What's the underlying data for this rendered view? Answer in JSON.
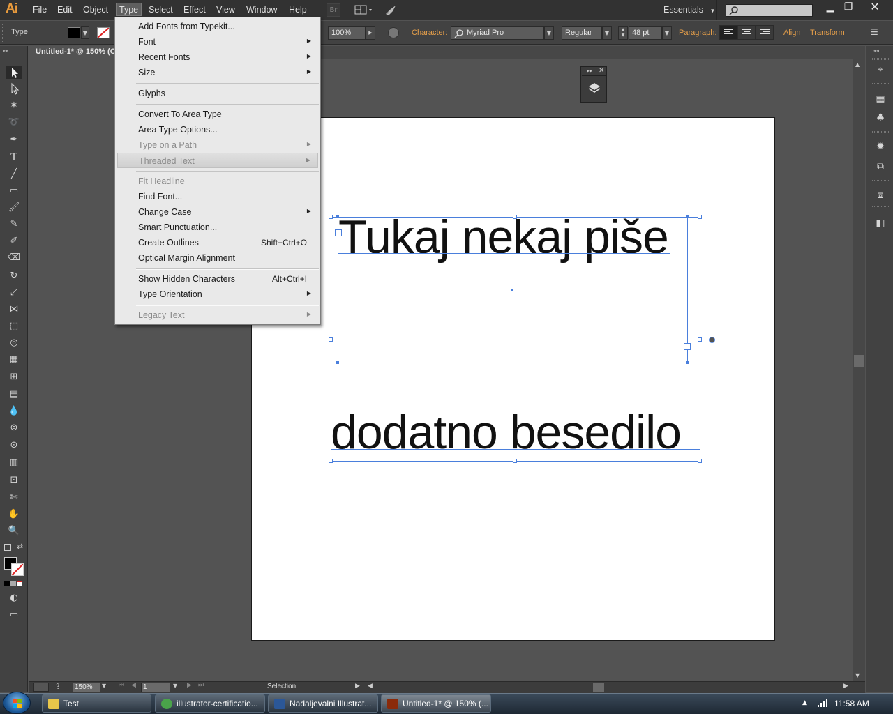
{
  "app": {
    "logo": "Ai",
    "menus": [
      "File",
      "Edit",
      "Object",
      "Type",
      "Select",
      "Effect",
      "View",
      "Window",
      "Help"
    ],
    "active_menu": "Type",
    "bridge_label": "Br",
    "workspace": "Essentials"
  },
  "control_bar": {
    "tool_label": "Type",
    "opacity": "100%",
    "character_label": "Character:",
    "font_family": "Myriad Pro",
    "font_style": "Regular",
    "font_size": "48 pt",
    "paragraph_label": "Paragraph:",
    "align_label": "Align",
    "transform_label": "Transform"
  },
  "document": {
    "tab_title": "Untitled-1* @ 150% (C"
  },
  "type_menu": {
    "items": [
      {
        "label": "Add Fonts from Typekit...",
        "submenu": false,
        "disabled": false
      },
      {
        "label": "Font",
        "submenu": true,
        "disabled": false
      },
      {
        "label": "Recent Fonts",
        "submenu": true,
        "disabled": false
      },
      {
        "label": "Size",
        "submenu": true,
        "disabled": false
      },
      {
        "label": "Glyphs",
        "submenu": false,
        "disabled": false
      },
      {
        "label": "Convert To Area Type",
        "submenu": false,
        "disabled": false
      },
      {
        "label": "Area Type Options...",
        "submenu": false,
        "disabled": false
      },
      {
        "label": "Type on a Path",
        "submenu": true,
        "disabled": true
      },
      {
        "label": "Threaded Text",
        "submenu": true,
        "disabled": true
      },
      {
        "label": "Fit Headline",
        "submenu": false,
        "disabled": true
      },
      {
        "label": "Find Font...",
        "submenu": false,
        "disabled": false
      },
      {
        "label": "Change Case",
        "submenu": true,
        "disabled": false
      },
      {
        "label": "Smart Punctuation...",
        "submenu": false,
        "disabled": false
      },
      {
        "label": "Create Outlines",
        "shortcut": "Shift+Ctrl+O",
        "submenu": false,
        "disabled": false
      },
      {
        "label": "Optical Margin Alignment",
        "submenu": false,
        "disabled": false
      },
      {
        "label": "Show Hidden Characters",
        "shortcut": "Alt+Ctrl+I",
        "submenu": false,
        "disabled": false
      },
      {
        "label": "Type Orientation",
        "submenu": true,
        "disabled": false
      },
      {
        "label": "Legacy Text",
        "submenu": true,
        "disabled": true
      }
    ]
  },
  "canvas": {
    "text_1": "Tukaj nekaj piše",
    "text_2": "dodatno besedilo"
  },
  "status_bar": {
    "zoom": "150%",
    "artboard_number": "1",
    "current_tool": "Selection"
  },
  "taskbar": {
    "items": [
      {
        "label": "Test",
        "icon_color": "#e8c64a"
      },
      {
        "label": "illustrator-certificatio...",
        "icon_color": "#4aa34a"
      },
      {
        "label": "Nadaljevalni Illustrat...",
        "icon_color": "#2b5797"
      },
      {
        "label": "Untitled-1* @ 150% (...",
        "icon_color": "#8a2a0a"
      }
    ],
    "clock": "11:58 AM"
  },
  "colors": {
    "selection_blue": "#4a7fdc",
    "accent_orange": "#e8a04a"
  }
}
